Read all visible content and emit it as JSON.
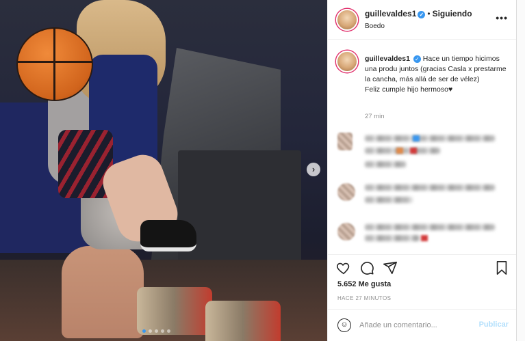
{
  "post": {
    "username": "guillevaldes1",
    "verified_glyph": "✓",
    "separator": "•",
    "follow_status": "Siguiendo",
    "location": "Boedo",
    "more_label": "•••"
  },
  "caption": {
    "username": "guillevaldes1",
    "text": "Hace un tiempo hicimos una produ juntos (gracias Casla x prestarme la cancha, más allá de ser de vélez)",
    "line2": "Feliz cumple hijo hermoso♥",
    "time": "27 min"
  },
  "photo": {
    "next_glyph": "›",
    "carousel_count": 5,
    "active_index": 0
  },
  "actions": {
    "like_icon": "heart-icon",
    "comment_icon": "comment-icon",
    "share_icon": "share-icon",
    "save_icon": "bookmark-icon"
  },
  "likes": "5.652 Me gusta",
  "posted_ago": "HACE 27 MINUTOS",
  "composer": {
    "placeholder": "Añade un comentario...",
    "emoji_glyph": "☺",
    "publish_label": "Publicar"
  },
  "colors": {
    "accent": "#3897f0",
    "publish_disabled": "#b2dffc",
    "ring": "#e1306c"
  }
}
